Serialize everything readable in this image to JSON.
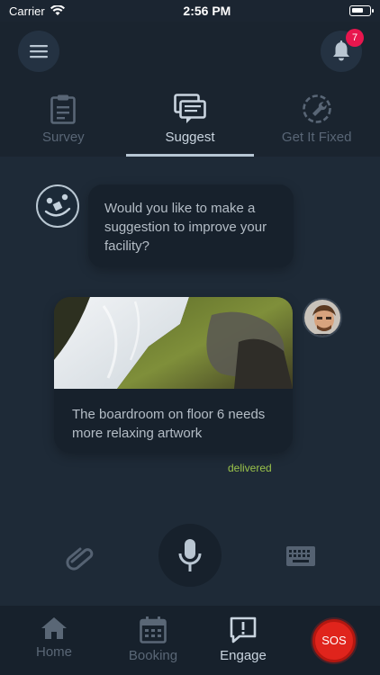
{
  "status_bar": {
    "carrier": "Carrier",
    "time": "2:56 PM"
  },
  "header": {
    "notification_count": "7"
  },
  "tabs": [
    {
      "label": "Survey",
      "icon": "clipboard-icon",
      "active": false
    },
    {
      "label": "Suggest",
      "icon": "suggestion-chat-icon",
      "active": true
    },
    {
      "label": "Get It Fixed",
      "icon": "wrench-icon",
      "active": false
    }
  ],
  "chat": {
    "bot_message": "Would you like to make a suggestion to improve your facility?",
    "user_message": "The boardroom on floor 6 needs more relaxing artwork",
    "message_status": "delivered"
  },
  "bottom_nav": {
    "items": [
      {
        "label": "Home",
        "icon": "home-icon",
        "active": false
      },
      {
        "label": "Booking",
        "icon": "calendar-icon",
        "active": false
      },
      {
        "label": "Engage",
        "icon": "alert-message-icon",
        "active": true
      }
    ],
    "sos_label": "SOS"
  },
  "colors": {
    "background": "#1e2a37",
    "bubble": "#17212c",
    "badge": "#e8164e",
    "delivered": "#9ac24a",
    "sos": "#e0241c"
  }
}
